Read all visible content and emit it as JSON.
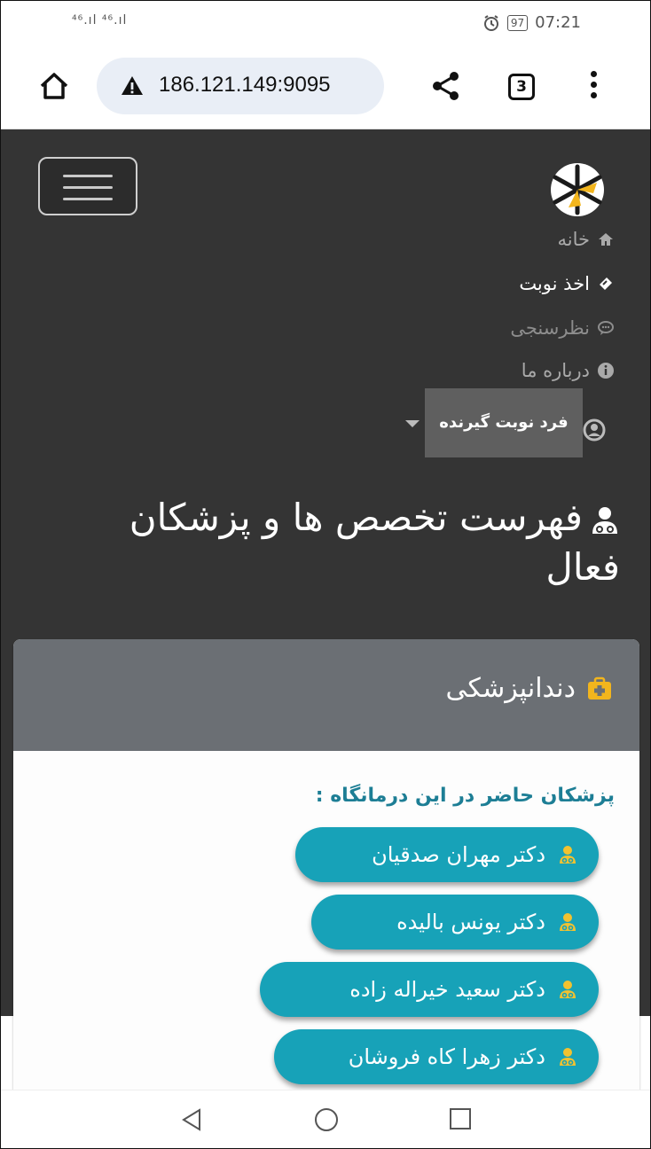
{
  "status_bar": {
    "signal": "⁴⁶.ıl ⁴⁶.ıl",
    "battery": "97",
    "time": "07:21"
  },
  "browser": {
    "url": "186.121.149:9095",
    "tab_count": "3"
  },
  "nav": {
    "items": [
      {
        "label": "خانه",
        "icon": "home-icon"
      },
      {
        "label": "اخذ نوبت",
        "icon": "ticket-icon"
      },
      {
        "label": "نظرسنجی",
        "icon": "comment-icon"
      },
      {
        "label": "درباره ما",
        "icon": "info-icon"
      }
    ],
    "user_dropdown": {
      "label": "فرد نوبت گیرنده",
      "icon": "user-icon"
    }
  },
  "page": {
    "heading": "فهرست تخصص ها و پزشکان فعال"
  },
  "specialty_card": {
    "title": "دندانپزشکی",
    "doctors_label": "پزشکان حاضر در این درمانگاه :",
    "doctors": [
      "دکتر مهران صدقیان",
      "دکتر یونس بالیده",
      "دکتر سعید خیراله زاده",
      "دکتر زهرا کاه فروشان"
    ]
  },
  "colors": {
    "navbar_bg": "#343434",
    "card_header_bg": "#6b6f74",
    "doctor_button_bg": "#17a2b8",
    "doctors_label": "#1d7e95",
    "annotation_red": "#d11f1f"
  }
}
